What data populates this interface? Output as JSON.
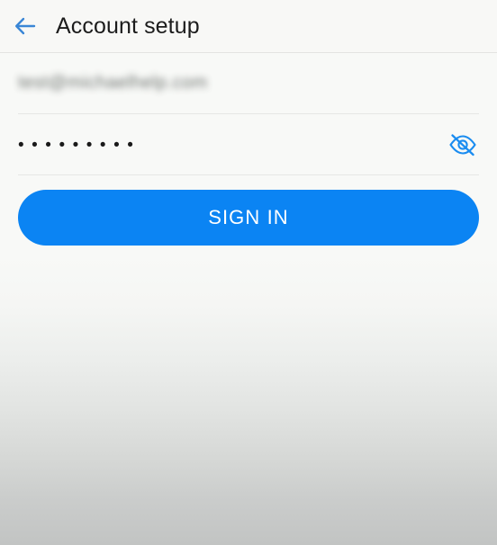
{
  "header": {
    "title": "Account setup",
    "back_icon": "arrow-left-icon",
    "accent_color": "#3a86d6"
  },
  "form": {
    "email_field": {
      "value": "test@michaelhelp.com",
      "redacted": true,
      "note": "blurred"
    },
    "password_field": {
      "value": "•••••••••",
      "dot_count": 9,
      "visibility_icon": "eye-off-icon",
      "visibility_icon_color": "#1a8cf0"
    }
  },
  "actions": {
    "sign_in_label": "SIGN IN",
    "sign_in_color": "#0b84f3",
    "sign_in_text_color": "#ffffff"
  },
  "background": {
    "top_color": "#f8f9f7",
    "bottom_color": "#c2c4c3"
  }
}
